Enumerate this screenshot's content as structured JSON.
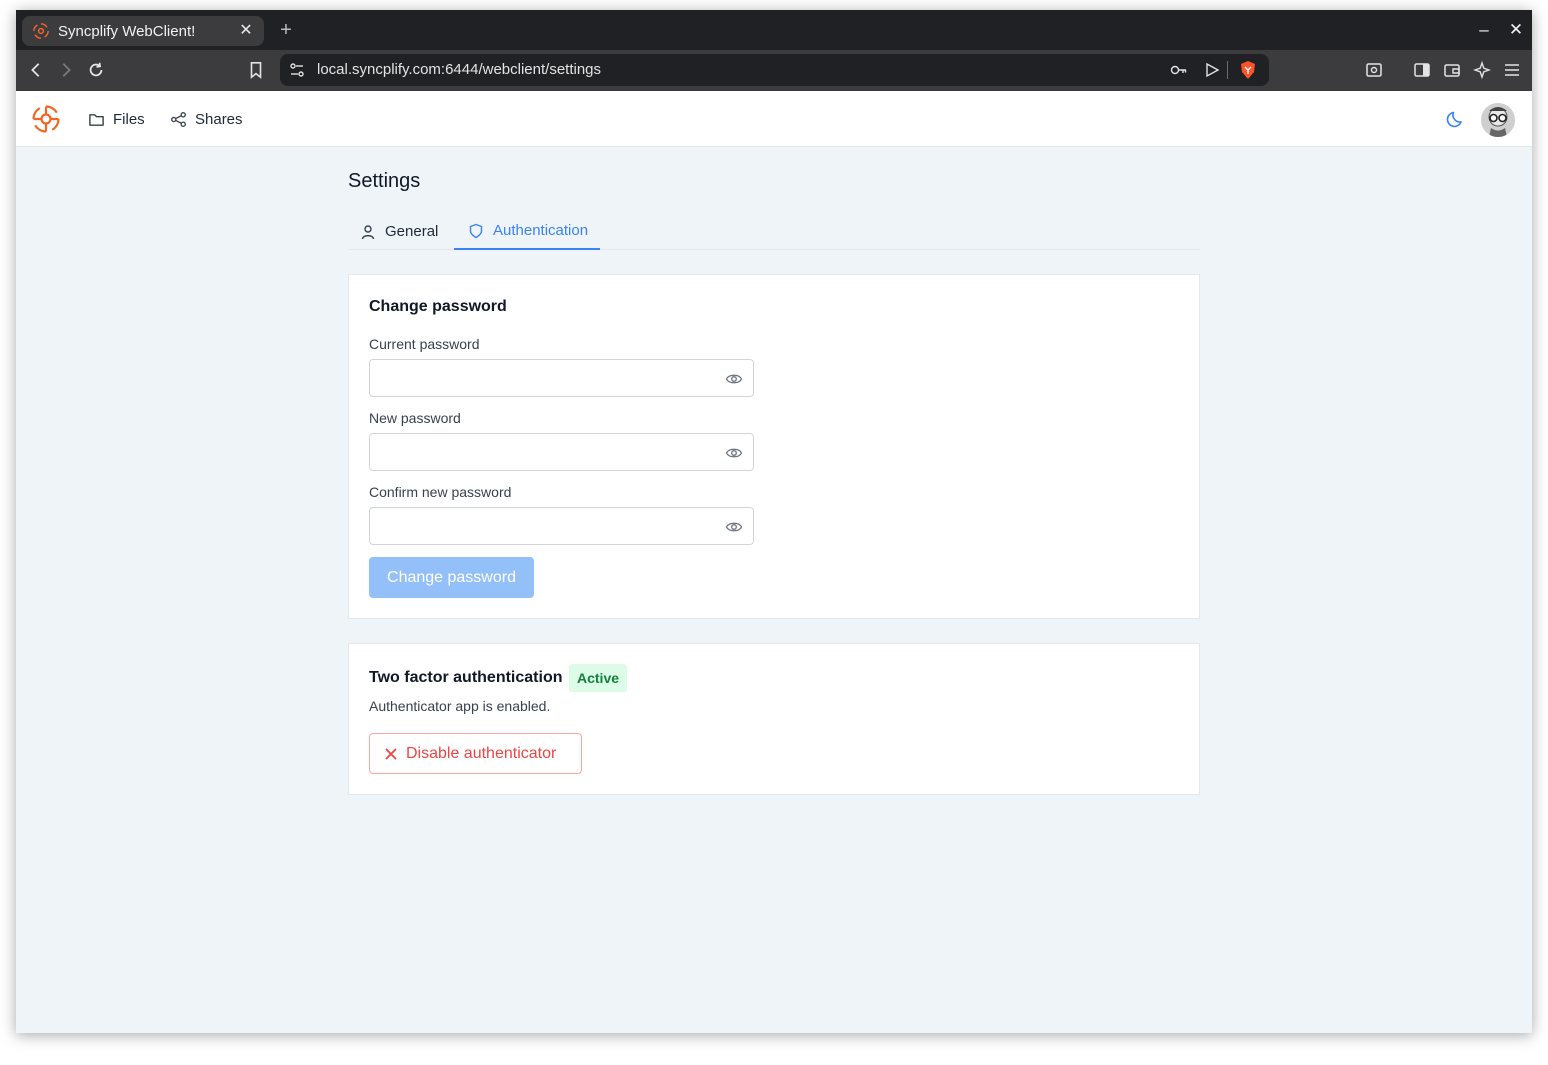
{
  "browser": {
    "tab_title": "Syncplify WebClient!",
    "url": "local.syncplify.com:6444/webclient/settings"
  },
  "header": {
    "nav": [
      {
        "label": "Files",
        "icon": "folder-icon"
      },
      {
        "label": "Shares",
        "icon": "share-icon"
      }
    ]
  },
  "page": {
    "title": "Settings",
    "tabs": [
      {
        "label": "General",
        "icon": "user-icon",
        "active": false
      },
      {
        "label": "Authentication",
        "icon": "shield-icon",
        "active": true
      }
    ]
  },
  "change_password": {
    "heading": "Change password",
    "fields": [
      {
        "label": "Current password",
        "value": ""
      },
      {
        "label": "New password",
        "value": ""
      },
      {
        "label": "Confirm new password",
        "value": ""
      }
    ],
    "button_label": "Change password"
  },
  "two_factor": {
    "heading": "Two factor authentication",
    "badge": "Active",
    "description": "Authenticator app is enabled.",
    "button_label": "Disable authenticator"
  },
  "colors": {
    "accent": "#3b82f6",
    "brand": "#f26522",
    "success_bg": "#dcfce7",
    "success_text": "#15803d",
    "danger": "#ef4444"
  }
}
